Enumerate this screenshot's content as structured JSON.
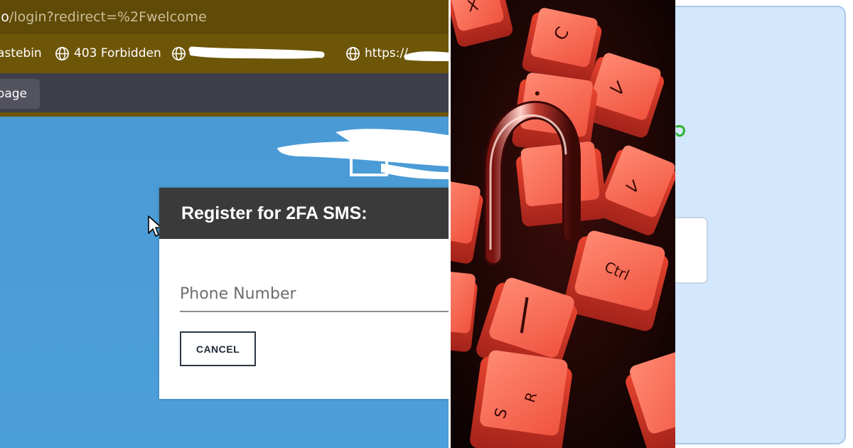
{
  "browser": {
    "url_host": "io",
    "url_path": "/login?redirect=%2Fwelcome",
    "bookmarks": [
      {
        "label": "astebin",
        "icon": "none"
      },
      {
        "label": "403 Forbidden",
        "icon": "globe-icon"
      },
      {
        "label": "",
        "icon": "globe-icon",
        "redacted": true
      },
      {
        "label": "https://",
        "icon": "globe-icon",
        "partially_redacted": true
      }
    ],
    "page_button": "page"
  },
  "dialog": {
    "title": "Register for 2FA SMS:",
    "phone_placeholder": "Phone Number",
    "cancel_label": "CANCEL"
  },
  "photo": {
    "subject": "open padlock on scattered red keyboard keys",
    "key_labels": [
      "Ctrl",
      "C",
      "X",
      "V",
      "R",
      "S"
    ]
  },
  "colors": {
    "address_bar": "#5f4a07",
    "bookmark_bar": "#6e5608",
    "app_bar": "#3f3f4b",
    "page_background": "#4b9bd6",
    "dialog_header": "#3a3a3a",
    "right_card": "#d3e7fd"
  }
}
